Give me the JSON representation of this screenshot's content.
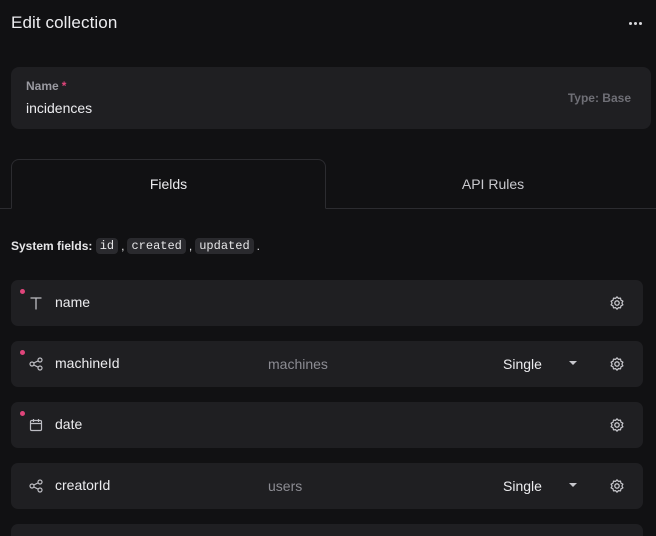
{
  "header": {
    "title": "Edit collection",
    "more_icon": "more-horizontal-icon"
  },
  "name_card": {
    "label": "Name",
    "required_mark": "*",
    "value": "incidences",
    "type_hint": "Type: Base"
  },
  "tabs": [
    {
      "label": "Fields",
      "active": true
    },
    {
      "label": "API Rules",
      "active": false
    }
  ],
  "system_fields": {
    "label": "System fields:",
    "items": [
      "id",
      "created",
      "updated"
    ],
    "sep1": ",",
    "sep2": ",",
    "end": "."
  },
  "fields": [
    {
      "name": "name",
      "icon": "text-icon",
      "required": true,
      "collection": "",
      "mode": ""
    },
    {
      "name": "machineId",
      "icon": "relation-icon",
      "required": true,
      "collection": "machines",
      "mode": "Single"
    },
    {
      "name": "date",
      "icon": "calendar-icon",
      "required": true,
      "collection": "",
      "mode": ""
    },
    {
      "name": "creatorId",
      "icon": "relation-icon",
      "required": false,
      "collection": "users",
      "mode": "Single"
    }
  ],
  "colors": {
    "accent_required": "#e0457b",
    "background": "#111113",
    "card": "#1f1f22"
  }
}
